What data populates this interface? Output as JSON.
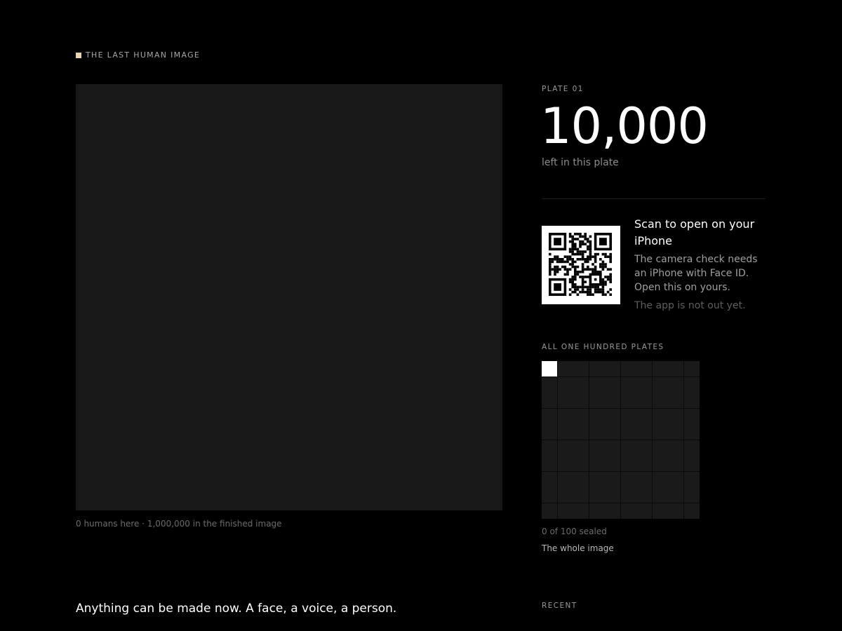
{
  "brand": {
    "title": "THE LAST HUMAN IMAGE",
    "mark_color": "#e8d5b5"
  },
  "canvas": {
    "caption": "0 humans here · 1,000,000 in the finished image",
    "background": "#181818"
  },
  "tagline": "Anything can be made now. A face, a voice, a person.",
  "plate": {
    "label": "PLATE 01",
    "count": "10,000",
    "count_sub": "left in this plate"
  },
  "scan": {
    "icon": "qr-code",
    "title": "Scan to open on your iPhone",
    "body": "The camera check needs an iPhone with Face ID. Open this on yours.",
    "note": "The app is not out yet."
  },
  "plates": {
    "label": "ALL ONE HUNDRED PLATES",
    "total": 100,
    "active_index": 0,
    "sealed_text": "0 of 100 sealed",
    "whole_link": "The whole image"
  },
  "recent": {
    "label": "RECENT"
  }
}
